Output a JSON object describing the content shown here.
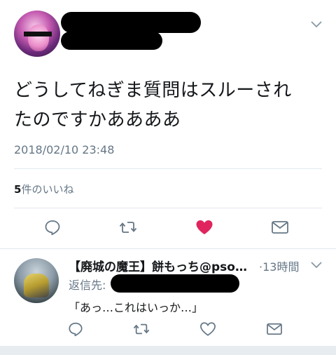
{
  "main_tweet": {
    "text_line1": "どうしてねぎま質問はスルーされ",
    "text_line2": "たのですかああああ",
    "timestamp": "2018/02/10 23:48",
    "likes_count": "5",
    "likes_label": "件のいいね",
    "liked": true
  },
  "reply": {
    "display_name": "【廃城の魔王】餅もっち@pso…",
    "time_ago": "·13時間",
    "reply_to_label": "返信先:",
    "text": "「あっ…これはいっか…」"
  },
  "colors": {
    "like_active": "#e0245e",
    "icon_gray": "#657786",
    "text_gray": "#657786"
  },
  "icons": [
    "reply-icon",
    "retweet-icon",
    "heart-icon",
    "dm-icon",
    "chevron-down-icon"
  ]
}
